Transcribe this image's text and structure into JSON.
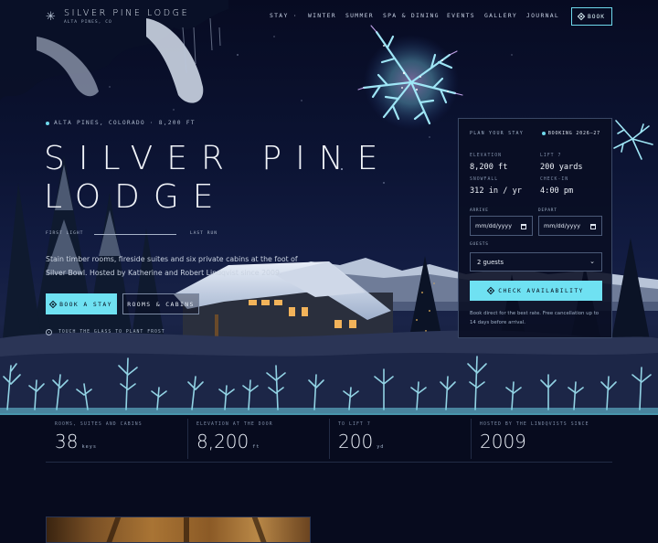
{
  "nav": {
    "brand_name": "SILVER PINE LODGE",
    "brand_location": "ALTA PINES, CO",
    "items": [
      "STAY ·",
      "WINTER",
      "SUMMER",
      "SPA & DINING",
      "EVENTS",
      "GALLERY",
      "JOURNAL"
    ],
    "book_label": "BOOK"
  },
  "hero": {
    "eyebrow": "ALTA PINES, COLORADO · 8,200 FT",
    "title_line1": "SILVER PINE",
    "title_line2": "LODGE",
    "range_left": "FIRST LIGHT",
    "range_right": "LAST RUN",
    "lead": "Stain timber rooms, fireside suites and six private cabins at the foot of Silver Bowl. Hosted by Katherine and Robert Lindqvist since 2009.",
    "cta_primary": "BOOK A STAY",
    "cta_secondary": "ROOMS & CABINS",
    "hint": "TOUCH THE GLASS TO PLANT FROST"
  },
  "booking": {
    "title": "PLAN YOUR STAY",
    "badge": "BOOKING 2026–27",
    "stats": [
      {
        "label": "ELEVATION",
        "value": "8,200 ft"
      },
      {
        "label": "LIFT 7",
        "value": "200 yards"
      },
      {
        "label": "SNOWFALL",
        "value": "312 in / yr"
      },
      {
        "label": "CHECK-IN",
        "value": "4:00 pm"
      }
    ],
    "arrive_label": "ARRIVE",
    "depart_label": "DEPART",
    "date_placeholder": "mm/dd/yyyy",
    "guests_label": "GUESTS",
    "guests_value": "2 guests",
    "check_label": "CHECK AVAILABILITY",
    "note": "Book direct for the best rate. Free cancellation up to 14 days before arrival."
  },
  "stats_band": [
    {
      "label": "ROOMS, SUITES AND CABINS",
      "value": "38",
      "unit": "keys"
    },
    {
      "label": "ELEVATION AT THE DOOR",
      "value": "8,200",
      "unit": "ft"
    },
    {
      "label": "TO LIFT 7",
      "value": "200",
      "unit": "yd"
    },
    {
      "label": "HOSTED BY THE LINDQVISTS SINCE",
      "value": "2009",
      "unit": ""
    }
  ],
  "colors": {
    "accent": "#6fe1f2",
    "background": "#060a1c",
    "panel": "#090e22",
    "frost": "#8fe4f4"
  },
  "icons": {
    "brand": "snowflake-icon",
    "book": "diamond-icon",
    "eyebrow": "dot-icon",
    "hint": "target-icon",
    "calendar": "calendar-icon",
    "select": "chevron-down-icon"
  }
}
